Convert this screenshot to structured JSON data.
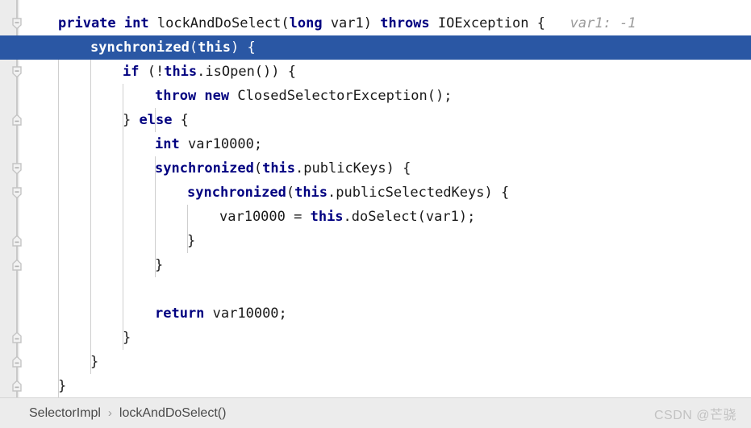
{
  "editor": {
    "language": "java",
    "selected_line_index": 1,
    "colors": {
      "selection_background": "#2a57a4",
      "gutter_background": "#ececec",
      "current_line_gutter": "#fdf8e3",
      "keyword": "#000080",
      "identifier": "#1a1a1a",
      "inline_hint": "#9a9a9a",
      "indent_guide": "#cfcfcf",
      "statusbar_background": "#ececec"
    },
    "lines": [
      {
        "indent": 1,
        "selected": false,
        "tokens": [
          {
            "t": "kw",
            "s": "private"
          },
          {
            "t": "id",
            "s": " "
          },
          {
            "t": "kw",
            "s": "int"
          },
          {
            "t": "id",
            "s": " lockAndDoSelect("
          },
          {
            "t": "kw",
            "s": "long"
          },
          {
            "t": "id",
            "s": " var1) "
          },
          {
            "t": "kw",
            "s": "throws"
          },
          {
            "t": "id",
            "s": " IOException {"
          },
          {
            "t": "hint",
            "s": "   var1: -1"
          }
        ]
      },
      {
        "indent": 2,
        "selected": true,
        "tokens": [
          {
            "t": "kw",
            "s": "synchronized"
          },
          {
            "t": "id",
            "s": "("
          },
          {
            "t": "kw",
            "s": "this"
          },
          {
            "t": "id",
            "s": ") {"
          }
        ]
      },
      {
        "indent": 3,
        "selected": false,
        "tokens": [
          {
            "t": "kw",
            "s": "if"
          },
          {
            "t": "id",
            "s": " (!"
          },
          {
            "t": "kw",
            "s": "this"
          },
          {
            "t": "id",
            "s": ".isOpen()) {"
          }
        ]
      },
      {
        "indent": 4,
        "selected": false,
        "tokens": [
          {
            "t": "kw",
            "s": "throw new"
          },
          {
            "t": "id",
            "s": " ClosedSelectorException();"
          }
        ]
      },
      {
        "indent": 3,
        "selected": false,
        "tokens": [
          {
            "t": "id",
            "s": "} "
          },
          {
            "t": "kw",
            "s": "else"
          },
          {
            "t": "id",
            "s": " {"
          }
        ]
      },
      {
        "indent": 4,
        "selected": false,
        "tokens": [
          {
            "t": "kw",
            "s": "int"
          },
          {
            "t": "id",
            "s": " var10000;"
          }
        ]
      },
      {
        "indent": 4,
        "selected": false,
        "tokens": [
          {
            "t": "kw",
            "s": "synchronized"
          },
          {
            "t": "id",
            "s": "("
          },
          {
            "t": "kw",
            "s": "this"
          },
          {
            "t": "id",
            "s": ".publicKeys) {"
          }
        ]
      },
      {
        "indent": 5,
        "selected": false,
        "tokens": [
          {
            "t": "kw",
            "s": "synchronized"
          },
          {
            "t": "id",
            "s": "("
          },
          {
            "t": "kw",
            "s": "this"
          },
          {
            "t": "id",
            "s": ".publicSelectedKeys) {"
          }
        ]
      },
      {
        "indent": 6,
        "selected": false,
        "tokens": [
          {
            "t": "id",
            "s": "var10000 = "
          },
          {
            "t": "kw",
            "s": "this"
          },
          {
            "t": "id",
            "s": ".doSelect(var1);"
          }
        ]
      },
      {
        "indent": 5,
        "selected": false,
        "tokens": [
          {
            "t": "id",
            "s": "}"
          }
        ]
      },
      {
        "indent": 4,
        "selected": false,
        "tokens": [
          {
            "t": "id",
            "s": "}"
          }
        ]
      },
      {
        "indent": 0,
        "selected": false,
        "tokens": []
      },
      {
        "indent": 4,
        "selected": false,
        "tokens": [
          {
            "t": "kw",
            "s": "return"
          },
          {
            "t": "id",
            "s": " var10000;"
          }
        ]
      },
      {
        "indent": 3,
        "selected": false,
        "tokens": [
          {
            "t": "id",
            "s": "}"
          }
        ]
      },
      {
        "indent": 2,
        "selected": false,
        "tokens": [
          {
            "t": "id",
            "s": "}"
          }
        ]
      },
      {
        "indent": 1,
        "selected": false,
        "tokens": [
          {
            "t": "id",
            "s": "}"
          }
        ]
      }
    ],
    "fold_markers": [
      {
        "line": 0,
        "type": "fold-start"
      },
      {
        "line": 1,
        "type": "fold-start"
      },
      {
        "line": 2,
        "type": "fold-start"
      },
      {
        "line": 4,
        "type": "fold-end"
      },
      {
        "line": 6,
        "type": "fold-start"
      },
      {
        "line": 7,
        "type": "fold-start"
      },
      {
        "line": 9,
        "type": "fold-end"
      },
      {
        "line": 10,
        "type": "fold-end"
      },
      {
        "line": 13,
        "type": "fold-end"
      },
      {
        "line": 14,
        "type": "fold-end"
      },
      {
        "line": 15,
        "type": "fold-end"
      }
    ],
    "indent_guides": [
      {
        "col": 1,
        "from": 1,
        "to": 15
      },
      {
        "col": 2,
        "from": 2,
        "to": 14
      },
      {
        "col": 3,
        "from": 3,
        "to": 13
      },
      {
        "col": 4,
        "from": 4,
        "to": 4
      },
      {
        "col": 4,
        "from": 6,
        "to": 10
      },
      {
        "col": 5,
        "from": 8,
        "to": 9
      }
    ]
  },
  "statusbar": {
    "breadcrumb": {
      "separator": "›",
      "items": [
        {
          "label": "SelectorImpl"
        },
        {
          "label": "lockAndDoSelect()"
        }
      ]
    },
    "watermark": "CSDN @芒骁"
  }
}
